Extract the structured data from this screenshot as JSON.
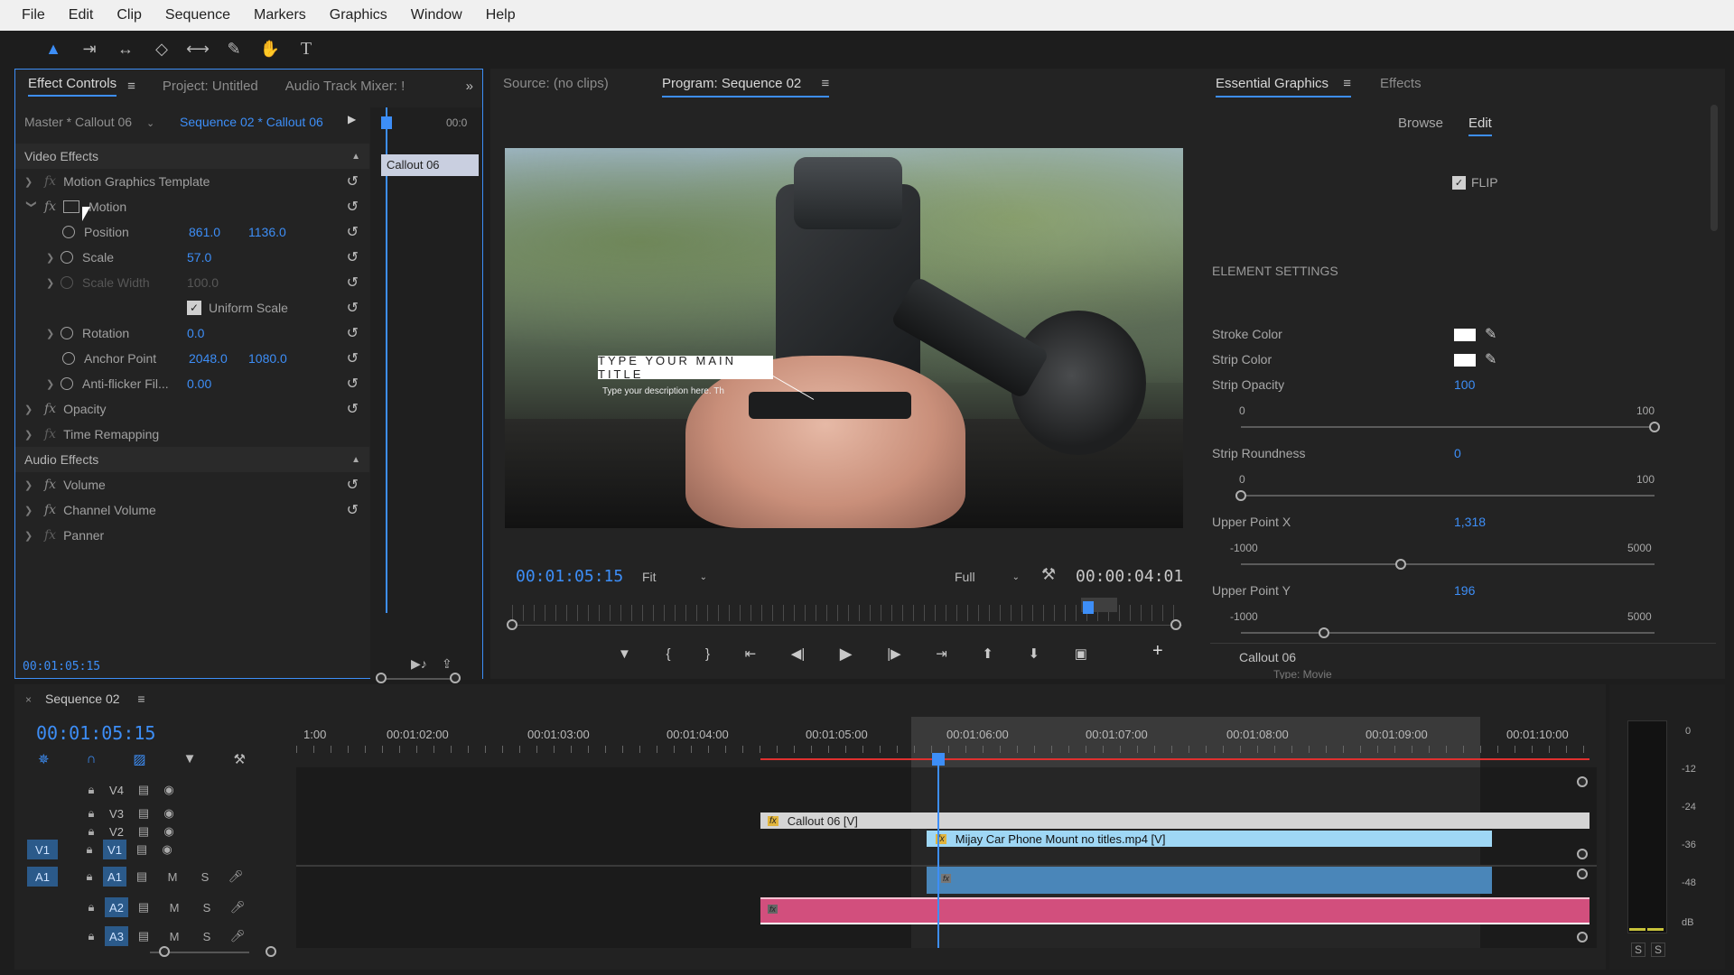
{
  "menu": [
    "File",
    "Edit",
    "Clip",
    "Sequence",
    "Markers",
    "Graphics",
    "Window",
    "Help"
  ],
  "effect_panel": {
    "tabs": [
      "Effect Controls",
      "Project: Untitled",
      "Audio Track Mixer: !"
    ],
    "master": "Master * Callout 06",
    "sequence": "Sequence 02 * Callout 06",
    "mini_time": "00:0",
    "clip_label": "Callout 06",
    "video_effects": "Video Effects",
    "rows": [
      {
        "name": "Motion Graphics Template"
      },
      {
        "name": "Motion"
      },
      {
        "name": "Position",
        "v1": "861.0",
        "v2": "1136.0"
      },
      {
        "name": "Scale",
        "v1": "57.0"
      },
      {
        "name": "Scale Width",
        "v1": "100.0"
      },
      {
        "name": "Uniform Scale"
      },
      {
        "name": "Rotation",
        "v1": "0.0"
      },
      {
        "name": "Anchor Point",
        "v1": "2048.0",
        "v2": "1080.0"
      },
      {
        "name": "Anti-flicker Fil...",
        "v1": "0.00"
      },
      {
        "name": "Opacity"
      },
      {
        "name": "Time Remapping"
      }
    ],
    "audio_effects": "Audio Effects",
    "audio_rows": [
      "Volume",
      "Channel Volume",
      "Panner"
    ],
    "timecode": "00:01:05:15"
  },
  "program": {
    "source_tab": "Source: (no clips)",
    "program_tab": "Program: Sequence 02",
    "title_text": "TYPE YOUR MAIN TITLE",
    "desc_text": "Type your description here. Th",
    "timecode": "00:01:05:15",
    "fit": "Fit",
    "quality": "Full",
    "duration": "00:00:04:01"
  },
  "essential": {
    "tabs": [
      "Essential Graphics",
      "Effects"
    ],
    "browse": "Browse",
    "edit": "Edit",
    "flip": "FLIP",
    "section": "ELEMENT SETTINGS",
    "stroke_color": "Stroke Color",
    "strip_color": "Strip Color",
    "strip_opacity": {
      "label": "Strip Opacity",
      "value": "100",
      "min": "0",
      "max": "100",
      "level": 1.0
    },
    "strip_roundness": {
      "label": "Strip Roundness",
      "value": "0",
      "min": "0",
      "max": "100",
      "level": 0.0
    },
    "upper_x": {
      "label": "Upper Point X",
      "value": "1,318",
      "min": "-1000",
      "max": "5000",
      "level": 0.386
    },
    "upper_y": {
      "label": "Upper Point Y",
      "value": "196",
      "min": "-1000",
      "max": "5000",
      "level": 0.2
    },
    "footer_title": "Callout 06",
    "footer_type": "Type: Movie"
  },
  "timeline": {
    "tab": "Sequence 02",
    "timecode": "00:01:05:15",
    "ruler": [
      "1:00",
      "00:01:02:00",
      "00:01:03:00",
      "00:01:04:00",
      "00:01:05:00",
      "00:01:06:00",
      "00:01:07:00",
      "00:01:08:00",
      "00:01:09:00",
      "00:01:10:00"
    ],
    "video_tracks": [
      "V4",
      "V3",
      "V2",
      "V1"
    ],
    "audio_tracks": [
      "A1",
      "A2",
      "A3"
    ],
    "source_v": "V1",
    "source_a": "A1",
    "m": "M",
    "s": "S",
    "clip_callout": "Callout 06 [V]",
    "clip_video": "Mijay Car Phone Mount no titles.mp4 [V]"
  },
  "meter": {
    "scale": [
      "0",
      "-12",
      "-24",
      "-36",
      "-48",
      "dB"
    ],
    "s1": "S",
    "s2": "S"
  },
  "colors": {
    "accent": "#3d8ef7",
    "audio_clip": "#d24f7d",
    "video_clip": "#9fd7f5"
  }
}
